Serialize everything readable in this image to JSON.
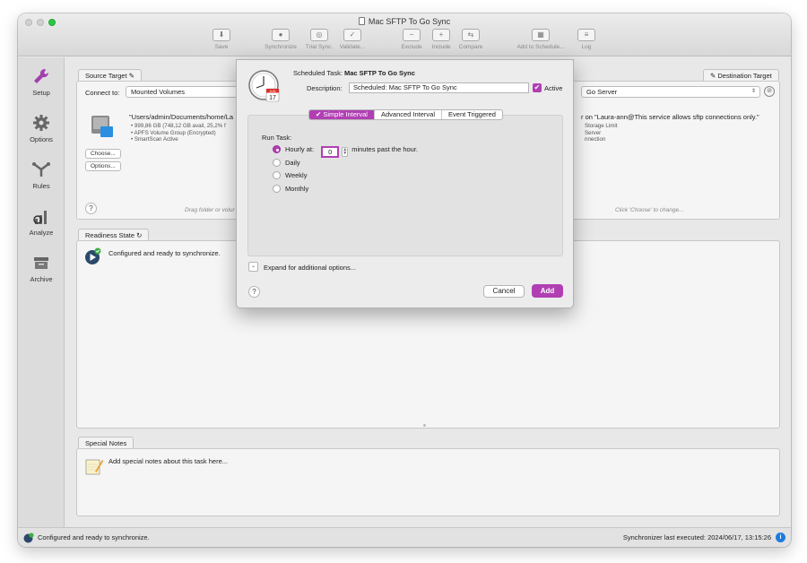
{
  "window": {
    "title": "Mac SFTP To Go Sync"
  },
  "toolbar": {
    "items": [
      {
        "label": "Save",
        "icon": "save-icon"
      },
      {
        "label": "Synchronize",
        "icon": "synchronize-icon"
      },
      {
        "label": "Trial Sync.",
        "icon": "trial-sync-icon"
      },
      {
        "label": "Validate...",
        "icon": "validate-icon"
      },
      {
        "label": "Exclude",
        "icon": "exclude-icon"
      },
      {
        "label": "Include",
        "icon": "include-icon"
      },
      {
        "label": "Compare",
        "icon": "compare-icon"
      },
      {
        "label": "Add to Schedule...",
        "icon": "add-to-schedule-icon"
      },
      {
        "label": "Log",
        "icon": "log-icon"
      }
    ]
  },
  "sidebar": {
    "items": [
      {
        "label": "Setup",
        "icon": "wrench-icon"
      },
      {
        "label": "Options",
        "icon": "gear-icon"
      },
      {
        "label": "Rules",
        "icon": "rules-icon"
      },
      {
        "label": "Analyze",
        "icon": "analyze-icon"
      },
      {
        "label": "Archive",
        "icon": "archive-icon"
      }
    ]
  },
  "source": {
    "tab_label": "Source Target",
    "connect_label": "Connect to:",
    "connect_value": "Mounted Volumes",
    "path": "\"Users/admin/Documents/home/La",
    "details": [
      "• 999,86 GB (748,12 GB avail, 25,2% f",
      "• APFS Volume Group (Encrypted)",
      "• SmartScan Active"
    ],
    "choose_label": "Choose...",
    "options_label": "Options...",
    "drag_hint": "Drag folder or volur"
  },
  "destination": {
    "tab_label": "Destination Target",
    "server_value": "Go Server",
    "description": "r on \"Laura-ann@This service allows sftp connections only.\"",
    "details": [
      "Storage Limit",
      "Server",
      "nnection"
    ],
    "hint": "Click 'Choose' to change..."
  },
  "readiness": {
    "tab_label": "Readiness State",
    "message": "Configured and ready to synchronize."
  },
  "notes": {
    "tab_label": "Special Notes",
    "placeholder": "Add special notes about this task here..."
  },
  "status_bar": {
    "left": "Configured and ready to synchronize.",
    "right": "Synchronizer last executed:  2024/06/17, 13:15:26"
  },
  "dialog": {
    "calendar_month": "JUN",
    "calendar_day": "17",
    "task_label": "Scheduled Task:",
    "task_name": "Mac SFTP To Go Sync",
    "description_label": "Description:",
    "description_value": "Scheduled: Mac SFTP To Go Sync",
    "active_label": "Active",
    "check_mark": "✔",
    "tabs": [
      "✔ Simple Interval",
      "Advanced Interval",
      "Event Triggered"
    ],
    "run_task_label": "Run Task:",
    "options": {
      "hourly": "Hourly at:",
      "minutes_value": "0",
      "minutes_suffix": "minutes past the hour.",
      "daily": "Daily",
      "weekly": "Weekly",
      "monthly": "Monthly"
    },
    "expand_label": "Expand for additional options...",
    "cancel_label": "Cancel",
    "add_label": "Add"
  },
  "colors": {
    "accent": "#b13fb3",
    "info": "#1f7ae0"
  }
}
